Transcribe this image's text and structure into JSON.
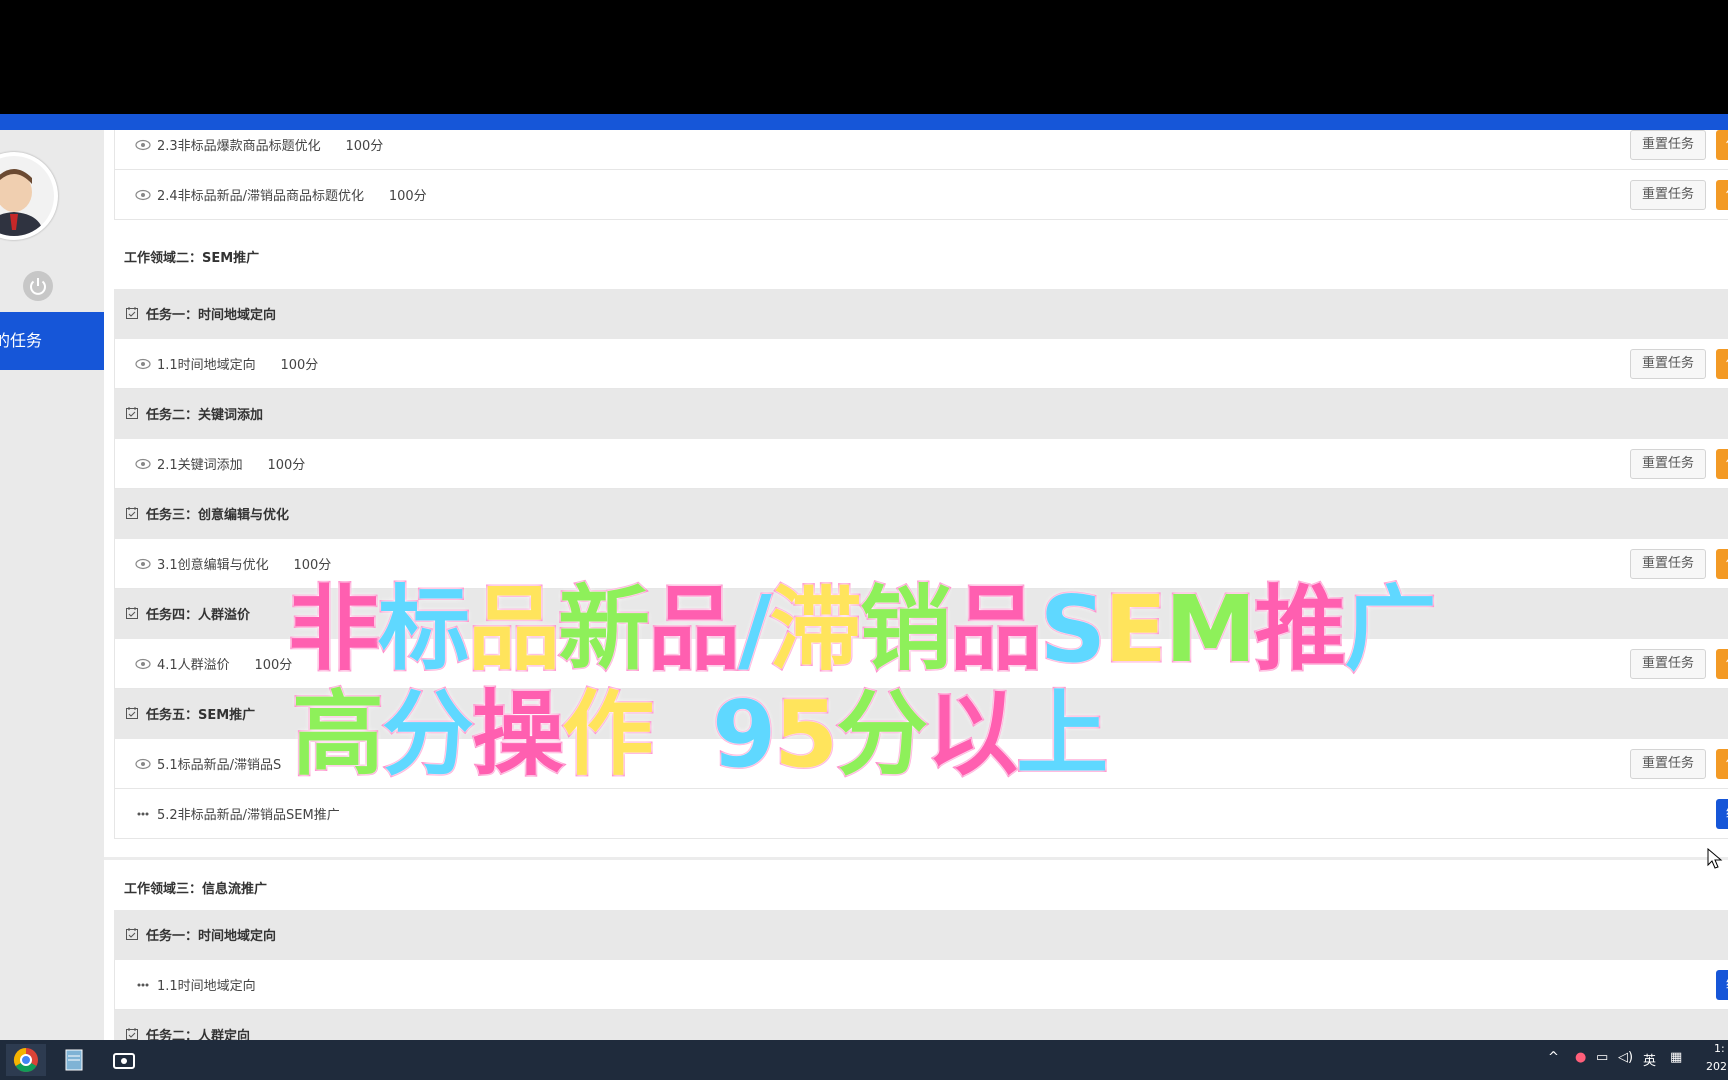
{
  "sidebar": {
    "nav_active": "的任务"
  },
  "area1": {
    "rows": [
      {
        "label": "2.3非标品爆款商品标题优化",
        "score": "100分"
      },
      {
        "label": "2.4非标品新品/滞销品商品标题优化",
        "score": "100分"
      }
    ]
  },
  "area2": {
    "title": "工作领域二：SEM推广",
    "tasks": [
      {
        "head": "任务一：时间地域定向",
        "row": "1.1时间地域定向",
        "score": "100分"
      },
      {
        "head": "任务二：关键词添加",
        "row": "2.1关键词添加",
        "score": "100分"
      },
      {
        "head": "任务三：创意编辑与优化",
        "row": "3.1创意编辑与优化",
        "score": "100分"
      },
      {
        "head": "任务四：人群溢价",
        "row": "4.1人群溢价",
        "score": "100分"
      },
      {
        "head": "任务五：SEM推广",
        "row": "5.1标品新品/滞销品S",
        "score": "",
        "row2": "5.2非标品新品/滞销品SEM推广"
      }
    ]
  },
  "area3": {
    "title": "工作领域三：信息流推广",
    "tasks": [
      {
        "head": "任务一：时间地域定向",
        "row": "1.1时间地域定向"
      },
      {
        "head": "任务二：人群定向"
      }
    ]
  },
  "buttons": {
    "reset": "重置任务",
    "orange": "任",
    "blue": "继"
  },
  "overlay": {
    "line1": "非标品新品/滞销品SEM推广",
    "line2": "高分操作  95分以上"
  },
  "taskbar": {
    "ime": "英",
    "time": "1:",
    "date": "202"
  },
  "colors": {
    "accent_blue": "#1656d8",
    "orange": "#f39a25",
    "overlay_stroke": "#ff7fc4"
  }
}
